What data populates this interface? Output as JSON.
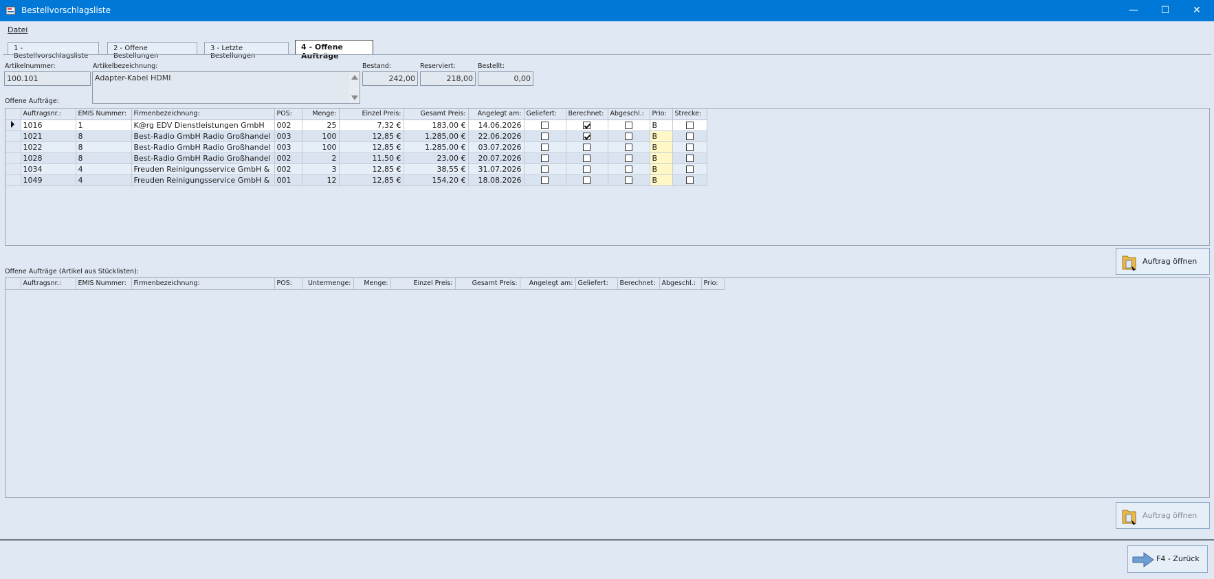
{
  "window": {
    "title": "Bestellvorschlagsliste",
    "minimize": "—",
    "maximize": "☐",
    "close": "✕"
  },
  "menu": {
    "datei": "Datei"
  },
  "tabs": [
    {
      "label": "1 - Bestellvorschlagsliste",
      "active": false
    },
    {
      "label": "2 - Offene Bestellungen",
      "active": false
    },
    {
      "label": "3 - Letzte Bestellungen",
      "active": false
    },
    {
      "label": "4 - Offene Aufträge",
      "active": true
    }
  ],
  "article": {
    "artikelnummer_label": "Artikelnummer:",
    "artikelnummer": "100.101",
    "bezeichnung_label": "Artikelbezeichnung:",
    "bezeichnung": "Adapter-Kabel HDMI",
    "bestand_label": "Bestand:",
    "bestand": "242,00",
    "reserviert_label": "Reserviert:",
    "reserviert": "218,00",
    "bestellt_label": "Bestellt:",
    "bestellt": "0,00"
  },
  "orders": {
    "section_label": "Offene Aufträge:",
    "columns": [
      "Auftragsnr.:",
      "EMIS Nummer:",
      "Firmenbezeichnung:",
      "POS:",
      "Menge:",
      "Einzel Preis:",
      "Gesamt Preis:",
      "Angelegt am:",
      "Geliefert:",
      "Berechnet:",
      "Abgeschl.:",
      "Prio:",
      "Strecke:"
    ],
    "rows": [
      {
        "auftragsnr": "1016",
        "emis": "1",
        "firma": "K@rg EDV Dienstleistungen GmbH",
        "pos": "002",
        "menge": "25",
        "einzel": "7,32 €",
        "gesamt": "183,00 €",
        "angelegt": "14.06.2026",
        "geliefert": false,
        "berechnet": true,
        "abgeschl": false,
        "prio": "B",
        "strecke": false
      },
      {
        "auftragsnr": "1021",
        "emis": "8",
        "firma": "Best-Radio GmbH Radio Großhandel",
        "pos": "003",
        "menge": "100",
        "einzel": "12,85 €",
        "gesamt": "1.285,00 €",
        "angelegt": "22.06.2026",
        "geliefert": false,
        "berechnet": true,
        "abgeschl": false,
        "prio": "B",
        "strecke": false
      },
      {
        "auftragsnr": "1022",
        "emis": "8",
        "firma": "Best-Radio GmbH Radio Großhandel",
        "pos": "003",
        "menge": "100",
        "einzel": "12,85 €",
        "gesamt": "1.285,00 €",
        "angelegt": "03.07.2026",
        "geliefert": false,
        "berechnet": false,
        "abgeschl": false,
        "prio": "B",
        "strecke": false
      },
      {
        "auftragsnr": "1028",
        "emis": "8",
        "firma": "Best-Radio GmbH Radio Großhandel",
        "pos": "002",
        "menge": "2",
        "einzel": "11,50 €",
        "gesamt": "23,00 €",
        "angelegt": "20.07.2026",
        "geliefert": false,
        "berechnet": false,
        "abgeschl": false,
        "prio": "B",
        "strecke": false
      },
      {
        "auftragsnr": "1034",
        "emis": "4",
        "firma": "Freuden Reinigungsservice GmbH &",
        "pos": "002",
        "menge": "3",
        "einzel": "12,85 €",
        "gesamt": "38,55 €",
        "angelegt": "31.07.2026",
        "geliefert": false,
        "berechnet": false,
        "abgeschl": false,
        "prio": "B",
        "strecke": false
      },
      {
        "auftragsnr": "1049",
        "emis": "4",
        "firma": "Freuden Reinigungsservice GmbH &",
        "pos": "001",
        "menge": "12",
        "einzel": "12,85 €",
        "gesamt": "154,20 €",
        "angelegt": "18.08.2026",
        "geliefert": false,
        "berechnet": false,
        "abgeschl": false,
        "prio": "B",
        "strecke": false
      }
    ],
    "open_button": "Auftrag öffnen"
  },
  "bom_orders": {
    "section_label": "Offene Aufträge (Artikel aus Stücklisten):",
    "columns": [
      "Auftragsnr.:",
      "EMIS Nummer:",
      "Firmenbezeichnung:",
      "POS:",
      "Untermenge:",
      "Menge:",
      "Einzel Preis:",
      "Gesamt Preis:",
      "Angelegt am:",
      "Geliefert:",
      "Berechnet:",
      "Abgeschl.:",
      "Prio:"
    ],
    "open_button": "Auftrag öffnen"
  },
  "footer": {
    "back_button": "F4 - Zurück"
  }
}
